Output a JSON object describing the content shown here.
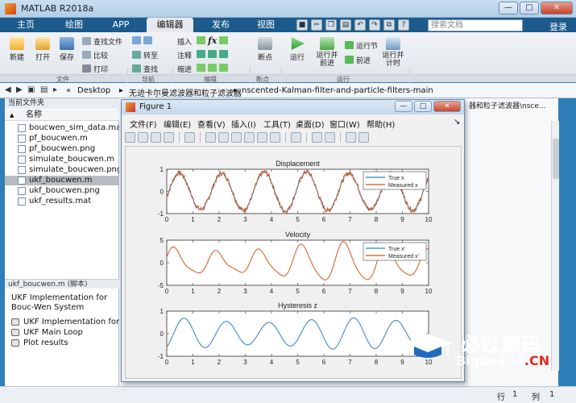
{
  "window": {
    "title": "MATLAB R2018a",
    "minimize": "—",
    "maximize": "□",
    "close": "✕"
  },
  "tabs": [
    "主页",
    "绘图",
    "APP",
    "编辑器",
    "发布",
    "视图"
  ],
  "search_placeholder": "搜索文档",
  "login": "登录",
  "ribbon": {
    "new": "新建",
    "open": "打开",
    "save": "保存",
    "find_files": "查找文件",
    "compare": "比较",
    "print": "打印",
    "goto": "转至",
    "find": "查找",
    "insert": "插入",
    "comment": "注释",
    "indent": "缩进",
    "breakpoints": "断点",
    "run": "运行",
    "run_advance": "运行并\n前进",
    "run_section": "运行节",
    "advance": "前进",
    "run_time": "运行并\n计时",
    "groups": [
      "文件",
      "导航",
      "编辑",
      "断点",
      "运行"
    ],
    "fx": "fx"
  },
  "address": {
    "path": [
      "Desktop",
      "无迹卡尔曼滤波器和粒子滤波器",
      "nscented-Kalman-filter-and-particle-filters-main"
    ],
    "right_crumb": "器和粒子滤波器\\nsce..."
  },
  "left_panel": {
    "title": "当前文件夹",
    "column": "名称",
    "sort": "▲",
    "files": [
      "boucwen_sim_data.mat",
      "pf_boucwen.m",
      "pf_boucwen.png",
      "simulate_boucwen.m",
      "simulate_boucwen.png",
      "ukf_boucwen.m",
      "ukf_boucwen.png",
      "ukf_results.mat"
    ],
    "selected_index": 5,
    "detail_title": "ukf_boucwen.m  (脚本)",
    "detail_heading": "UKF Implementation for Bouc-Wen System",
    "detail_items": [
      "UKF Implementation for Bo...",
      "UKF Main Loop",
      "Plot results"
    ]
  },
  "figure": {
    "title": "Figure 1",
    "menu": [
      "文件(F)",
      "编辑(E)",
      "查看(V)",
      "插入(I)",
      "工具(T)",
      "桌面(D)",
      "窗口(W)",
      "帮助(H)"
    ],
    "buttons": {
      "min": "—",
      "max": "□",
      "close": "✕"
    }
  },
  "chart_data": [
    {
      "type": "line",
      "title": "Displacement",
      "x_range": [
        0,
        10
      ],
      "ylim": [
        -1,
        1
      ],
      "xticks": [
        0,
        1,
        2,
        3,
        4,
        5,
        6,
        7,
        8,
        9,
        10
      ],
      "yticks": [
        -1,
        0,
        1
      ],
      "legend": [
        "True x",
        "Measured x"
      ],
      "legend_position": "top-right",
      "series": [
        {
          "name": "True x",
          "color": "#2f7fc1",
          "amplitude": 0.85,
          "period": 1.62
        },
        {
          "name": "Measured x",
          "color": "#d4561b",
          "amplitude": 0.85,
          "period": 1.62,
          "noise": 0.1
        }
      ]
    },
    {
      "type": "line",
      "title": "Velocity",
      "x_range": [
        0,
        10
      ],
      "ylim": [
        -5,
        5
      ],
      "xticks": [
        0,
        1,
        2,
        3,
        4,
        5,
        6,
        7,
        8,
        9,
        10
      ],
      "yticks": [
        -5,
        0,
        5
      ],
      "legend": [
        "True x'",
        "Measured x'"
      ],
      "legend_position": "top-right",
      "series": [
        {
          "name": "True x'",
          "color": "#2f7fc1"
        },
        {
          "name": "Measured x'",
          "color": "#d4561b",
          "amplitude": 3.2,
          "period": 1.62
        }
      ]
    },
    {
      "type": "line",
      "title": "Hysteresis z",
      "x_range": [
        0,
        10
      ],
      "ylim": [
        -1,
        1
      ],
      "xticks": [
        0,
        1,
        2,
        3,
        4,
        5,
        6,
        7,
        8,
        9,
        10
      ],
      "yticks": [
        -1,
        0,
        1
      ],
      "series": [
        {
          "color": "#2f7fc1",
          "amplitude": 0.68,
          "period": 1.62
        }
      ]
    }
  ],
  "status": {
    "row_label": "行",
    "row": "1",
    "col_label": "列",
    "col": "1"
  },
  "watermark": {
    "cn": "必过源码",
    "en_main": "Biguo100",
    "en_suffix": ".CN"
  },
  "colors": {
    "true_line": "#2f7fc1",
    "measured_line": "#d4561b",
    "tab_bar": "#1c5b8c"
  }
}
